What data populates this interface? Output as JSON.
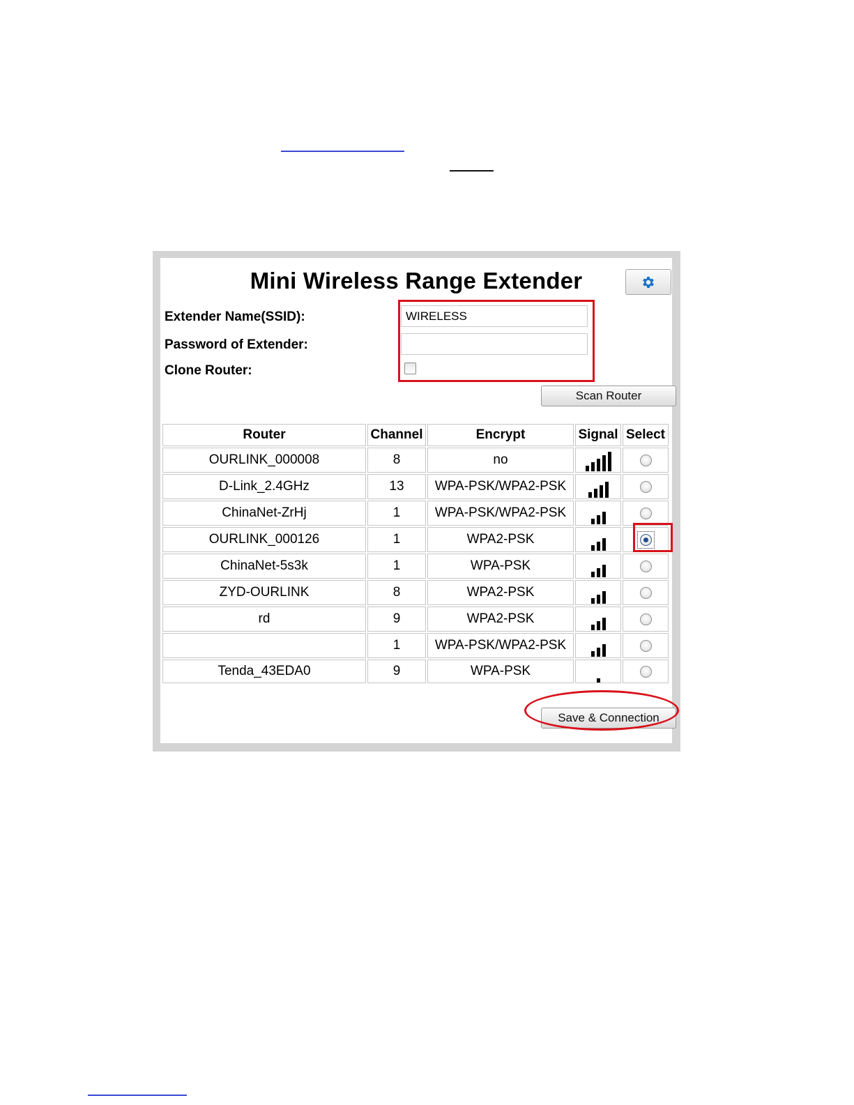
{
  "page": {
    "title": "Mini Wireless Range Extender",
    "settings_icon": "gear-icon",
    "accent": "#d8121b"
  },
  "form": {
    "ssid_label": "Extender Name(SSID):",
    "ssid_value": "WIRELESS",
    "password_label": "Password of Extender:",
    "password_value": "",
    "clone_label": "Clone Router:",
    "clone_checked": false
  },
  "buttons": {
    "scan": "Scan Router",
    "save": "Save & Connection"
  },
  "table": {
    "headers": [
      "Router",
      "Channel",
      "Encrypt",
      "Signal",
      "Select"
    ],
    "rows": [
      {
        "router": "OURLINK_000008",
        "channel": "8",
        "encrypt": "no",
        "signal": 5,
        "selected": false
      },
      {
        "router": "D-Link_2.4GHz",
        "channel": "13",
        "encrypt": "WPA-PSK/WPA2-PSK",
        "signal": 4,
        "selected": false
      },
      {
        "router": "ChinaNet-ZrHj",
        "channel": "1",
        "encrypt": "WPA-PSK/WPA2-PSK",
        "signal": 3,
        "selected": false
      },
      {
        "router": "OURLINK_000126",
        "channel": "1",
        "encrypt": "WPA2-PSK",
        "signal": 3,
        "selected": true
      },
      {
        "router": "ChinaNet-5s3k",
        "channel": "1",
        "encrypt": "WPA-PSK",
        "signal": 3,
        "selected": false
      },
      {
        "router": "ZYD-OURLINK",
        "channel": "8",
        "encrypt": "WPA2-PSK",
        "signal": 3,
        "selected": false
      },
      {
        "router": "rd",
        "channel": "9",
        "encrypt": "WPA2-PSK",
        "signal": 3,
        "selected": false
      },
      {
        "router": "",
        "channel": "1",
        "encrypt": "WPA-PSK/WPA2-PSK",
        "signal": 3,
        "selected": false
      },
      {
        "router": "Tenda_43EDA0",
        "channel": "9",
        "encrypt": "WPA-PSK",
        "signal": 1,
        "selected": false
      }
    ]
  }
}
